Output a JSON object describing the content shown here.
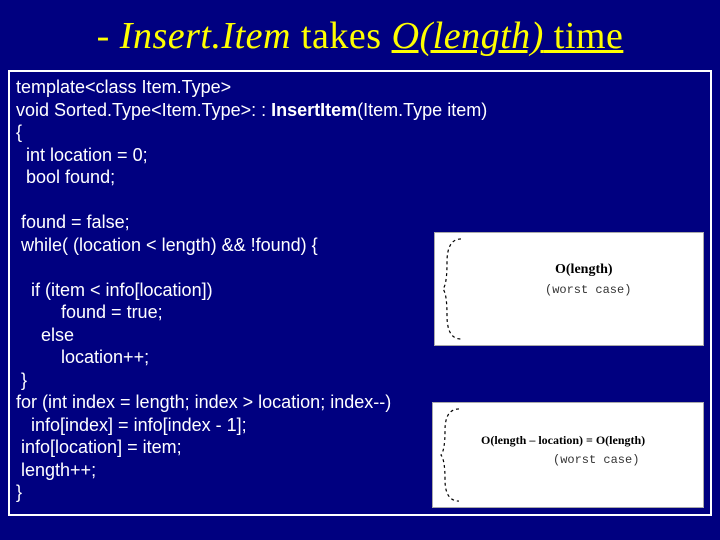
{
  "title": {
    "prefix": "- ",
    "italic1": "Insert.Item",
    "mid": " takes ",
    "italic2": "O(length)",
    "end": " time"
  },
  "code": {
    "l1": "template<class Item.Type>",
    "l2a": "void Sorted.Type<Item.Type>: : ",
    "l2b": "InsertItem",
    "l2c": "(Item.Type item)",
    "l3": "{",
    "l4": "  int location = 0;",
    "l5": "  bool found;",
    "blank1": " ",
    "l6": " found = false;",
    "l7": " while( (location < length) && !found) {",
    "blank2": " ",
    "l8": "   if (item < info[location])",
    "l9": "         found = true;",
    "l10": "     else",
    "l11": "         location++;",
    "l12": " }",
    "l13": "for (int index = length; index > location; index--)",
    "l14": "   info[index] = info[index - 1];",
    "l15": " info[location] = item;",
    "l16": " length++;",
    "l17": "}"
  },
  "panel1": {
    "label": "O(length)",
    "sub": "(worst case)"
  },
  "panel2": {
    "label": "O(length – location) = O(length)",
    "sub": "(worst case)"
  }
}
